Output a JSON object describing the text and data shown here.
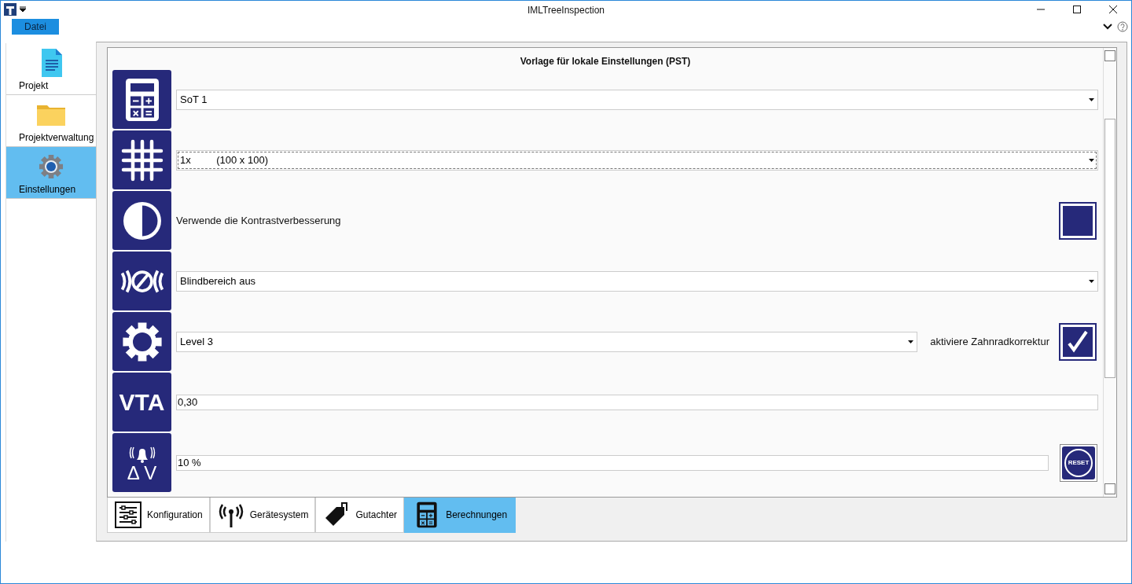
{
  "window": {
    "title": "IMLTreeInspection"
  },
  "menu": [
    {
      "label": "Datei",
      "selected": true
    }
  ],
  "sidebar": {
    "items": [
      {
        "label": "Projekt",
        "selected": false
      },
      {
        "label": "Projektverwaltung",
        "selected": false
      },
      {
        "label": "Einstellungen",
        "selected": true
      }
    ]
  },
  "panel": {
    "title": "Vorlage für lokale Einstellungen (PST)",
    "rows": [
      {
        "kind": "dropdown",
        "value": "SoT 1",
        "focused": false
      },
      {
        "kind": "dropdown",
        "value": "1x         (100 x 100)",
        "focused": true
      },
      {
        "kind": "checkbox",
        "label": "Verwende die Kontrastverbesserung",
        "checked": false
      },
      {
        "kind": "dropdown",
        "value": "Blindbereich aus",
        "focused": false
      },
      {
        "kind": "dropdown_checkbox",
        "value": "Level 3",
        "label": "aktiviere Zahnradkorrektur",
        "checked": true
      },
      {
        "kind": "field",
        "icon_text": "VTA",
        "value": "0,30"
      },
      {
        "kind": "field_reset",
        "icon_text": "Δ V",
        "value": "10 %",
        "button": "RESET"
      }
    ]
  },
  "tabs": [
    {
      "label": "Konfiguration",
      "selected": false
    },
    {
      "label": "Gerätesystem",
      "selected": false
    },
    {
      "label": "Gutachter",
      "selected": false
    },
    {
      "label": "Berechnungen",
      "selected": true
    }
  ]
}
